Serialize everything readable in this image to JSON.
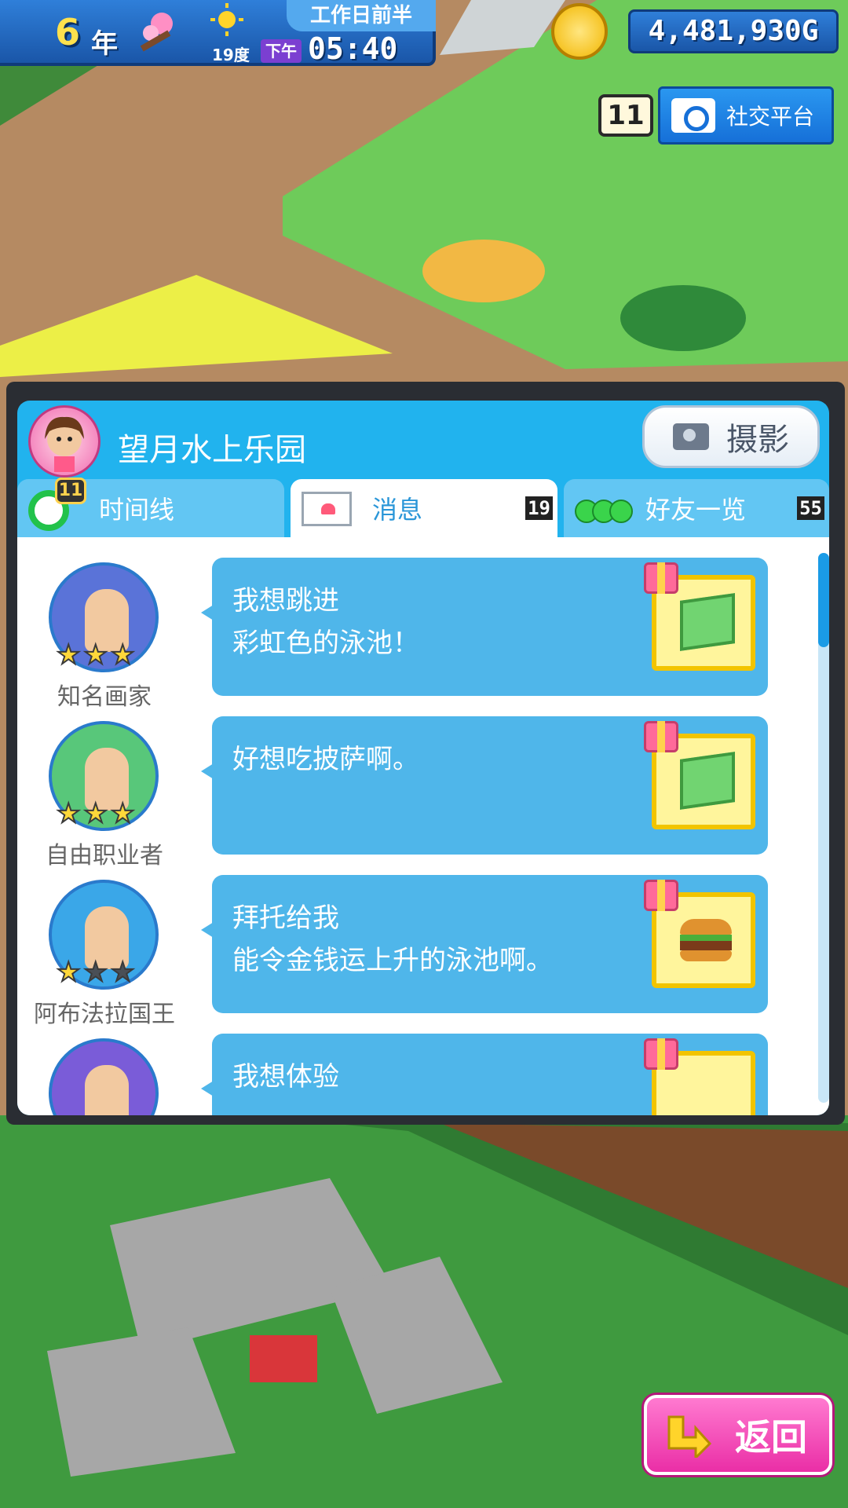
{
  "hud": {
    "year_number": "6",
    "year_suffix": "年",
    "weekday": "工作日前半",
    "temperature": "19度",
    "ampm": "下午",
    "time": "05:40",
    "money": "4,481,930G",
    "weather_icon": "sun-icon",
    "season_icon": "cherry-blossom-icon"
  },
  "social": {
    "count": "11",
    "label": "社交平台",
    "icon": "camera-icon"
  },
  "panel": {
    "park_name": "望月水上乐园",
    "photo_label": "摄影",
    "tabs": [
      {
        "label": "时间线",
        "badge": "11",
        "icon": "clock-icon"
      },
      {
        "label": "消息",
        "count": "19",
        "icon": "envelope-icon",
        "active": true
      },
      {
        "label": "好友一览",
        "count": "55",
        "icon": "friends-icon"
      }
    ],
    "messages": [
      {
        "job": "知名画家",
        "text": "我想跳进\n彩虹色的泳池！",
        "stars": 3,
        "gift": "cube",
        "bg": "#5a73d8"
      },
      {
        "job": "自由职业者",
        "text": "好想吃披萨啊。",
        "stars": 3,
        "gift": "cube",
        "bg": "#58c77a"
      },
      {
        "job": "阿布法拉国王",
        "text": "拜托给我\n能令金钱运上升的泳池啊。",
        "stars": 1,
        "gift": "burger",
        "bg": "#3aa7e8"
      },
      {
        "job": "",
        "text": "我想体验",
        "stars": 0,
        "gift": "other",
        "bg": "#7a5cd8"
      }
    ]
  },
  "back": {
    "label": "返回",
    "icon": "return-arrow-icon"
  },
  "colors": {
    "panel_accent": "#21b3ee",
    "bubble": "#4fb6ea",
    "back_button": "#ea2ea6"
  }
}
